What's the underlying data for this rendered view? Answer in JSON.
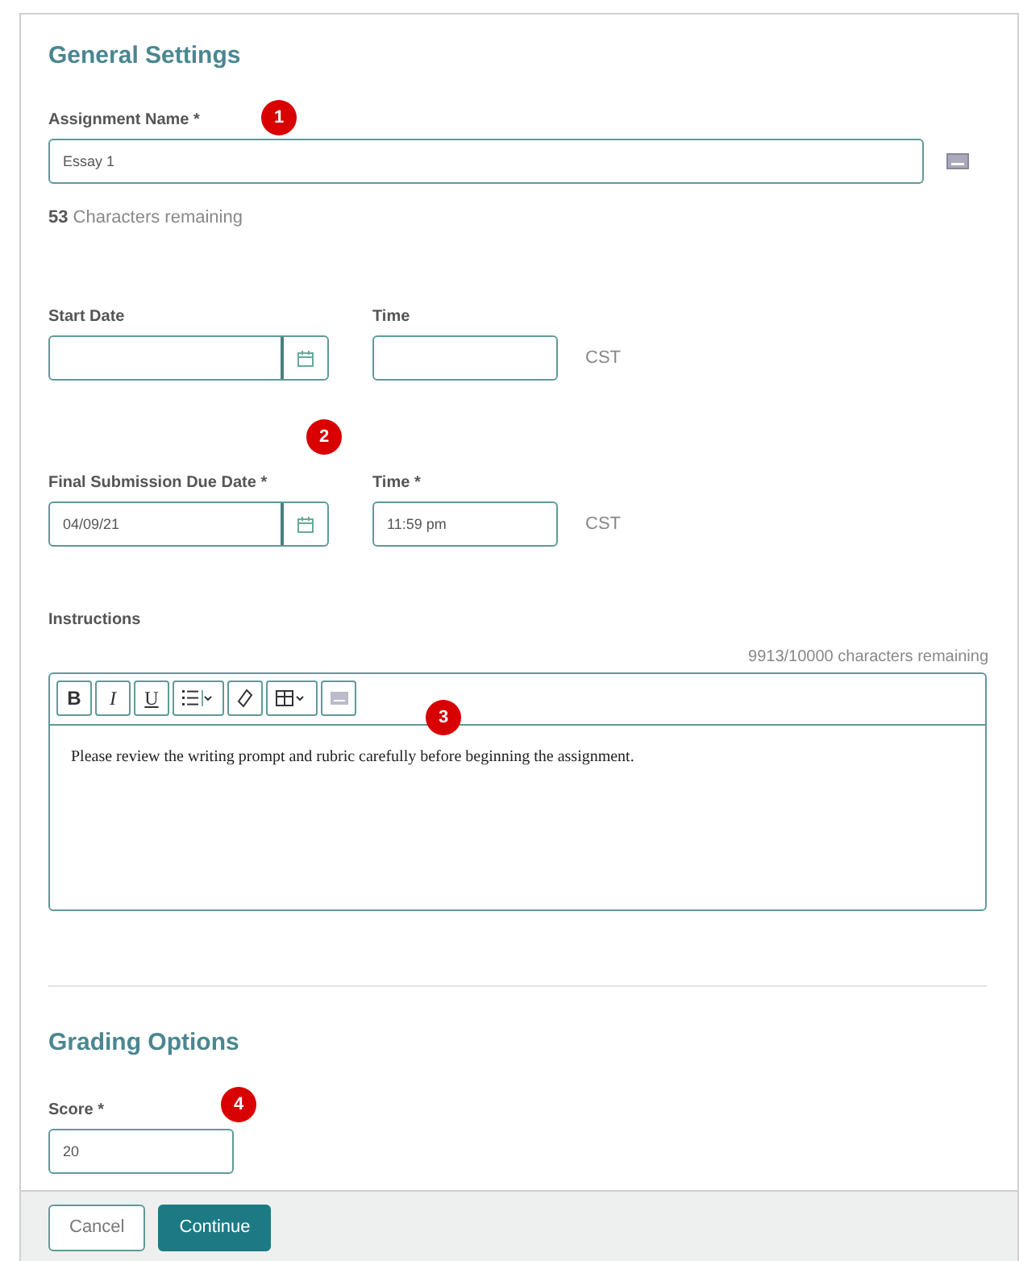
{
  "general_settings": {
    "title": "General Settings",
    "assignment_name": {
      "label": "Assignment Name *",
      "value": "Essay 1",
      "remaining_count": "53",
      "remaining_text": "Characters remaining"
    },
    "date_rows": [
      {
        "date_label": "Start Date",
        "date_value": "",
        "time_label": "Time",
        "time_value": "",
        "zone": "CST"
      },
      {
        "date_label": "Final Submission Due Date *",
        "date_value": "04/09/21",
        "time_label": "Time *",
        "time_value": "11:59 pm",
        "zone": "CST"
      }
    ],
    "instructions": {
      "label": "Instructions",
      "remaining": "9913/10000 characters remaining",
      "toolbar": [
        {
          "kind": "bold",
          "label": "B"
        },
        {
          "kind": "italic",
          "label": "I"
        },
        {
          "kind": "underline",
          "label": "U"
        },
        {
          "kind": "list"
        },
        {
          "kind": "link"
        },
        {
          "kind": "table"
        },
        {
          "kind": "keyboard"
        }
      ],
      "text": "Please review the writing prompt and rubric carefully before beginning the assignment."
    }
  },
  "grading_options": {
    "title": "Grading Options",
    "score": {
      "label": "Score *",
      "value": "20"
    }
  },
  "callouts": [
    "1",
    "2",
    "3",
    "4"
  ],
  "footer": {
    "buttons": [
      {
        "label": "Cancel",
        "kind": "secondary"
      },
      {
        "label": "Continue",
        "kind": "primary"
      }
    ]
  }
}
